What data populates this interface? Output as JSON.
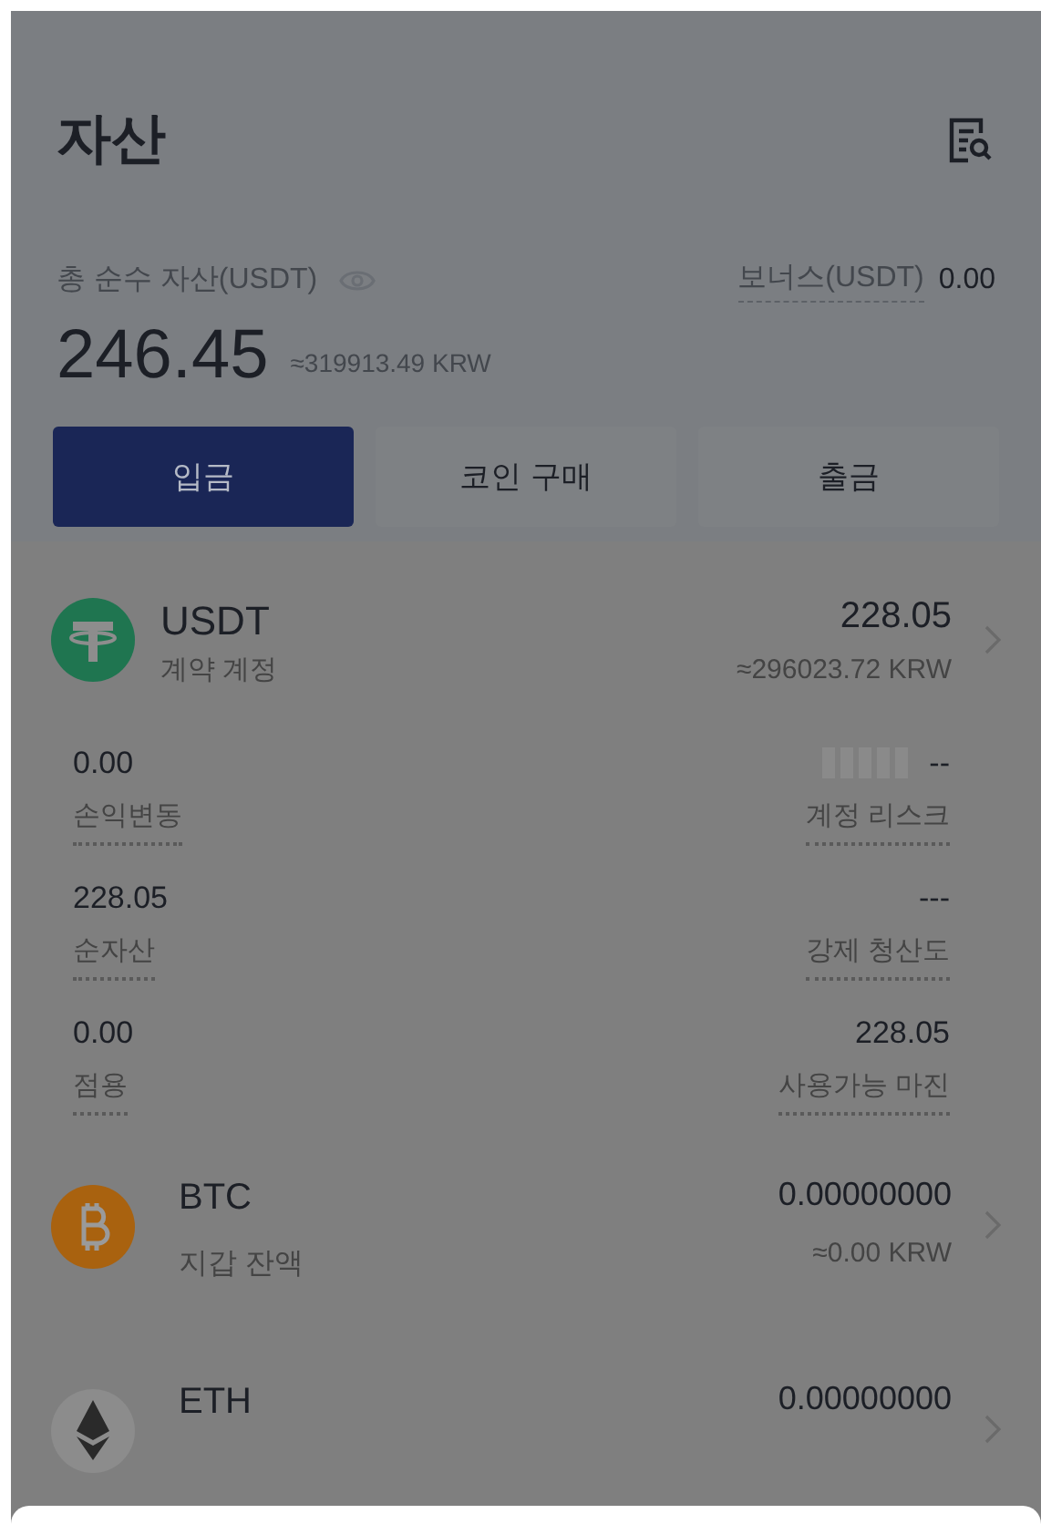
{
  "header": {
    "title": "자산"
  },
  "summary": {
    "total_label": "총 순수 자산(USDT)",
    "bonus_label": "보너스(USDT)",
    "bonus_value": "0.00",
    "total_value": "246.45",
    "total_krw": "≈319913.49 KRW"
  },
  "actions": [
    {
      "label": "입금",
      "selected": true
    },
    {
      "label": "코인 구매",
      "selected": false
    },
    {
      "label": "출금",
      "selected": false
    }
  ],
  "usdt": {
    "name": "USDT",
    "account": "계약 계정",
    "amount": "228.05",
    "krw": "≈296023.72 KRW",
    "stats": [
      {
        "value": "0.00",
        "label": "손익변동",
        "kind": "text"
      },
      {
        "value": "--",
        "label": "계정 리스크",
        "kind": "meter"
      },
      {
        "value": "228.05",
        "label": "순자산",
        "kind": "text"
      },
      {
        "value": "---",
        "label": "강제 청산도",
        "kind": "text"
      },
      {
        "value": "0.00",
        "label": "점용",
        "kind": "text"
      },
      {
        "value": "228.05",
        "label": "사용가능 마진",
        "kind": "text"
      }
    ]
  },
  "coins": [
    {
      "name": "BTC",
      "account": "지갑 잔액",
      "amount": "0.00000000",
      "krw": "≈0.00 KRW",
      "kind": "btc"
    },
    {
      "name": "ETH",
      "amount": "0.00000000",
      "kind": "eth"
    }
  ]
}
